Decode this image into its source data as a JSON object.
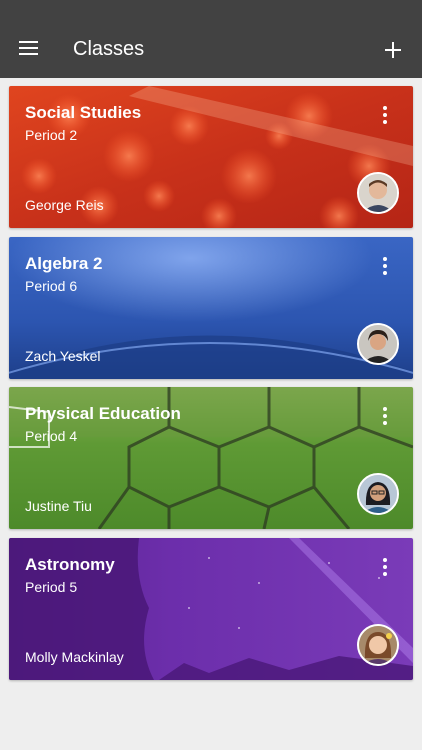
{
  "header": {
    "title": "Classes",
    "menu_icon": "hamburger-menu-icon",
    "add_icon": "plus-icon",
    "background": "#424242"
  },
  "classes": [
    {
      "name": "Social Studies",
      "period": "Period 2",
      "teacher": "George Reis",
      "theme_color": "#d63a1e",
      "more_icon": "more-vertical-icon"
    },
    {
      "name": "Algebra 2",
      "period": "Period 6",
      "teacher": "Zach Yeskel",
      "theme_color": "#2f57b6",
      "more_icon": "more-vertical-icon"
    },
    {
      "name": "Physical Education",
      "period": "Period 4",
      "teacher": "Justine Tiu",
      "theme_color": "#5a8f2e",
      "more_icon": "more-vertical-icon"
    },
    {
      "name": "Astronomy",
      "period": "Period 5",
      "teacher": "Molly Mackinlay",
      "theme_color": "#6a2aa8",
      "more_icon": "more-vertical-icon"
    }
  ]
}
